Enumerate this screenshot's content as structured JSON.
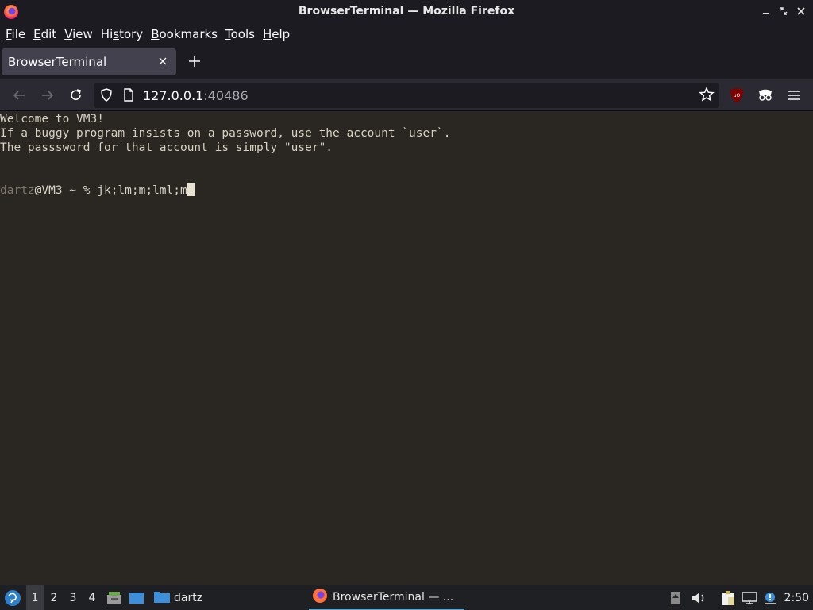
{
  "window": {
    "title": "BrowserTerminal — Mozilla Firefox",
    "controls": [
      "minimize",
      "restore",
      "close"
    ]
  },
  "menubar": {
    "items": [
      {
        "label": "File",
        "accel": "F"
      },
      {
        "label": "Edit",
        "accel": "E"
      },
      {
        "label": "View",
        "accel": "V"
      },
      {
        "label": "History",
        "accel": "s"
      },
      {
        "label": "Bookmarks",
        "accel": "B"
      },
      {
        "label": "Tools",
        "accel": "T"
      },
      {
        "label": "Help",
        "accel": "H"
      }
    ]
  },
  "tabs": [
    {
      "title": "BrowserTerminal",
      "active": true
    }
  ],
  "navbar": {
    "url_host": "127.0.0.1",
    "url_port": ":40486"
  },
  "terminal": {
    "lines": [
      "Welcome to VM3!",
      "If a buggy program insists on a password, use the account `user`.",
      "The passsword for that account is simply \"user\"."
    ],
    "prompt_user": "dartz",
    "prompt_rest": "@VM3 ~ % ",
    "input": "jk;lm;m;lml;m"
  },
  "taskbar": {
    "workspaces": [
      "1",
      "2",
      "3",
      "4"
    ],
    "active_workspace": "1",
    "folder_label": "dartz",
    "window_label": "BrowserTerminal — ...",
    "clock": "2:50"
  },
  "colors": {
    "accent": "#3daee9",
    "terminal_bg": "#2a2723",
    "terminal_fg": "#d7d2c4",
    "firefox_chrome": "#1c1b22"
  }
}
